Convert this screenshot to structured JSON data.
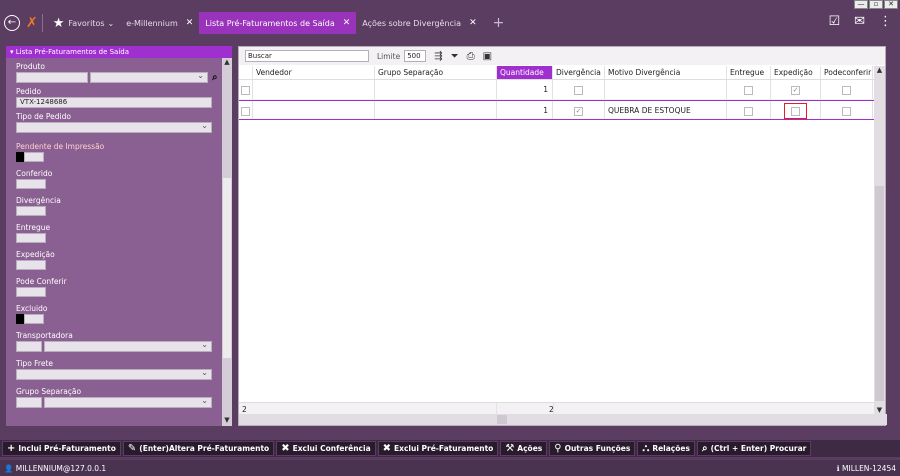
{
  "window": {
    "buttons": [
      "—",
      "▫",
      "✕"
    ]
  },
  "tabs": [
    {
      "label": "Favoritos",
      "suffix": "⌄"
    },
    {
      "label": "e-Millennium"
    },
    {
      "label": "Lista Pré-Faturamentos de Saída",
      "active": true
    },
    {
      "label": "Ações sobre Divergência"
    }
  ],
  "left": {
    "title": "Lista Pré-Faturamentos de Saída",
    "produto_label": "Produto",
    "pedido_label": "Pedido",
    "pedido_value": "VTX-1248686",
    "tipo_pedido_label": "Tipo de Pedido",
    "pendente_label": "Pendente de Impressão",
    "conferido_label": "Conferido",
    "divergencia_label": "Divergência",
    "entregue_label": "Entregue",
    "expedicao_label": "Expedição",
    "pode_conferir_label": "Pode Conferir",
    "excluido_label": "Excluido",
    "transportadora_label": "Transportadora",
    "tipo_frete_label": "Tipo Frete",
    "grupo_sep_label": "Grupo Separação"
  },
  "toolbar": {
    "buscar": "Buscar",
    "limite_label": "Limite",
    "limite_value": "500"
  },
  "grid": {
    "headers": [
      "Vendedor",
      "Grupo Separação",
      "Quantidade",
      "Divergência",
      "Motivo Divergência",
      "Entregue",
      "Expedição",
      "Podeconferir"
    ],
    "rows": [
      {
        "quantidade": "1",
        "motivo": ""
      },
      {
        "quantidade": "1",
        "motivo": "QUEBRA DE ESTOQUE"
      }
    ],
    "footer_count": "2",
    "footer_qty": "2"
  },
  "actions": [
    {
      "icon": "+",
      "label": "Inclui Pré-Faturamento"
    },
    {
      "icon": "✎",
      "label": "(Enter)Altera Pré-Faturamento"
    },
    {
      "icon": "✖",
      "label": "Exclui Conferência"
    },
    {
      "icon": "✖",
      "label": "Exclui Pré-Faturamento"
    },
    {
      "icon": "⚒",
      "label": "Ações"
    },
    {
      "icon": "⚲",
      "label": "Outras Funções"
    },
    {
      "icon": "⛬",
      "label": "Relações"
    },
    {
      "icon": "⌕",
      "label": "(Ctrl + Enter) Procurar"
    }
  ],
  "status": {
    "user": "MILLENNIUM@127.0.0.1",
    "right": "MILLEN-12454"
  }
}
